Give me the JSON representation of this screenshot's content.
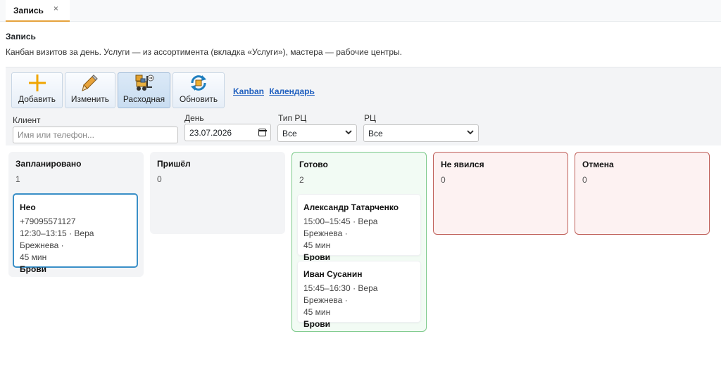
{
  "tab": {
    "label": "Запись",
    "close": "×"
  },
  "page": {
    "title": "Запись",
    "description": "Канбан визитов за день. Услуги — из ассортимента (вкладка «Услуги»), мастера — рабочие центры."
  },
  "toolbar": {
    "add_label": "Добавить",
    "edit_label": "Изменить",
    "expense_label": "Расходная",
    "refresh_label": "Обновить",
    "view_kanban": "Kanban",
    "view_calendar": "Календарь"
  },
  "filters": {
    "client_label": "Клиент",
    "client_placeholder": "Имя или телефон...",
    "client_value": "",
    "day_label": "День",
    "day_value": "23.07.2026",
    "rc_type_label": "Тип РЦ",
    "rc_type_value": "Все",
    "rc_label": "РЦ",
    "rc_value": "Все"
  },
  "columns": [
    {
      "title": "Запланировано",
      "count": "1",
      "cards": [
        {
          "name": "Нео",
          "phone": "+79095571127",
          "time_line": "12:30–13:15 · Вера Брежнева ·",
          "duration": "45 мин",
          "service": "Брови"
        }
      ]
    },
    {
      "title": "Пришёл",
      "count": "0",
      "cards": []
    },
    {
      "title": "Готово",
      "count": "2",
      "cards": [
        {
          "name": "Александр Татарченко",
          "time_line": "15:00–15:45 · Вера Брежнева ·",
          "duration": "45 мин",
          "service": "Брови"
        },
        {
          "name": "Иван Сусанин",
          "time_line": "15:45–16:30 · Вера Брежнева ·",
          "duration": "45 мин",
          "service": "Брови"
        }
      ]
    },
    {
      "title": "Не явился",
      "count": "0",
      "cards": []
    },
    {
      "title": "Отмена",
      "count": "0",
      "cards": []
    }
  ],
  "colors": {
    "tab_accent": "#e6a23c",
    "link": "#1f5fbf",
    "selected_card_border": "#3a8fc7",
    "done_border": "#7cc98a",
    "negative_border": "#c0605a",
    "add_icon": "#f0a500"
  },
  "icons": {
    "add": "plus-icon",
    "edit": "pencil-icon",
    "expense": "forklift-icon",
    "refresh": "refresh-icon",
    "calendar": "calendar-icon",
    "select": "chevron-down-icon"
  }
}
